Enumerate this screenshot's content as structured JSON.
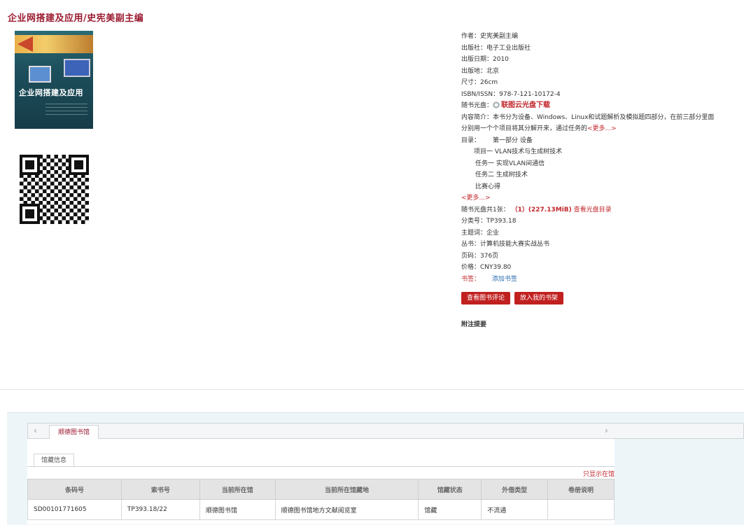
{
  "title": "企业网搭建及应用/史宪美副主编",
  "cover": {
    "title_text": "企业网搭建及应用"
  },
  "info": {
    "author": "作者：史宪美副主编",
    "publisher": "出版社：电子工业出版社",
    "pub_date": "出版日期：2010",
    "pub_place": "出版地：北京",
    "size": "尺寸：26cm",
    "isbn": "ISBN/ISSN：978-7-121-10172-4",
    "cd_label": "随书光盘：",
    "cd_download": "联图云光盘下载",
    "summary_line1": "内容简介：本书分为设备、Windows、Linux和试题解析及模拟题四部分，在前三部分里面",
    "summary_line2": "分别用一个个项目将其分解开来，通过任务的",
    "summary_more": "<更多...>",
    "toc_label": "目录：",
    "toc_first": "第一部分 设备",
    "toc_items": [
      "项目一 VLAN技术与生成树技术",
      "任务一 实现VLAN间通信",
      "任务二 生成树技术",
      "比赛心得"
    ],
    "toc_more": "<更多...>",
    "cd_count_label": "随书光盘共1张：",
    "cd_count_value": "（1）(227.13MiB)",
    "cd_view": "查看光盘目录",
    "class_no": "分类号：TP393.18",
    "subject": "主题词：企业",
    "series": "丛书：计算机技能大赛实战丛书",
    "pages": "页码：376页",
    "price": "价格：CNY39.80",
    "tag_label": "书签：",
    "tag_add": "添加书签"
  },
  "buttons": {
    "review": "查看图书评论",
    "shelf": "放入我的书架"
  },
  "note_label": "附注提要",
  "tabs": {
    "prev": "‹",
    "next": "›",
    "library": "顺德图书馆"
  },
  "holdings": {
    "subtab": "馆藏信息",
    "show_link": "只显示在馆",
    "headers": [
      "条码号",
      "索书号",
      "当前所在馆",
      "当前所在馆藏地",
      "馆藏状态",
      "外借类型",
      "卷册说明"
    ],
    "rows": [
      [
        "SD00101771605",
        "TP393.18/22",
        "顺德图书馆",
        "顺德图书馆地方文献阅览室",
        "馆藏",
        "不流通",
        ""
      ]
    ]
  }
}
